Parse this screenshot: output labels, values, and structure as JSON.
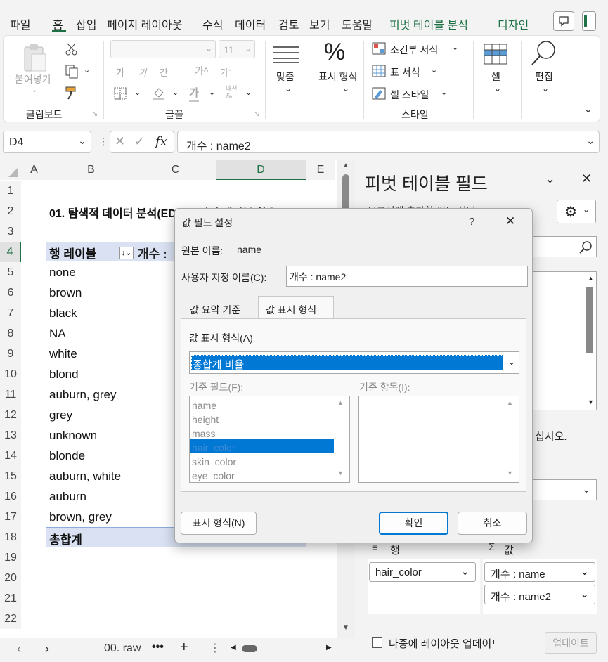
{
  "menu": {
    "file": "파일",
    "home": "홈",
    "insert": "삽입",
    "page_layout": "페이지 레이아웃",
    "formulas": "수식",
    "data": "데이터",
    "review": "검토",
    "view": "보기",
    "help": "도움말",
    "pivot_analyze": "피벗 테이블 분석",
    "design": "디자인"
  },
  "ribbon": {
    "paste": "붙여넣기",
    "clipboard": "클립보드",
    "font_size": "11",
    "font_group": "글꼴",
    "align": "맞춤",
    "number_format": "표시 형식",
    "conditional": "조건부 서식",
    "table_format": "표 서식",
    "cell_style": "셀 스타일",
    "styles": "스타일",
    "cells": "셀",
    "editing": "편집"
  },
  "formula": {
    "name_box": "D4",
    "fx": "fx",
    "value": "개수 : name2"
  },
  "columns": [
    "A",
    "B",
    "C",
    "D",
    "E"
  ],
  "rows": [
    "1",
    "2",
    "3",
    "4",
    "5",
    "6",
    "7",
    "8",
    "9",
    "10",
    "11",
    "12",
    "13",
    "14",
    "15",
    "16",
    "17",
    "18",
    "19",
    "20",
    "21",
    "22"
  ],
  "sheet": {
    "title": "01. 탐색적 데이터 분석(EDA) - 피벗 테이블 활용",
    "row_label_header": "행 레이블",
    "count_header": "개수 : ",
    "items": [
      "none",
      "brown",
      "black",
      "NA",
      "white",
      "blond",
      "auburn, grey",
      "grey",
      "unknown",
      "blonde",
      "auburn, white",
      "auburn",
      "brown, grey"
    ],
    "grand_total": "총합계",
    "tab": "00. raw"
  },
  "pane": {
    "title": "피벗 테이블 필드",
    "subtitle": "보고서에 추가할 필드 선택:",
    "drag_hint": "십시오.",
    "rows_label": "행",
    "values_label": "값",
    "row_field": "hair_color",
    "value_fields": [
      "개수 : name",
      "개수 : name2"
    ],
    "defer_label": "나중에 레이아웃 업데이트",
    "update_btn": "업데이트"
  },
  "dialog": {
    "title": "값 필드 설정",
    "help": "?",
    "source_label": "원본 이름:",
    "source_value": "name",
    "custom_label": "사용자 지정 이름(C):",
    "custom_value": "개수 : name2",
    "tab1": "값 요약 기준",
    "tab2": "값 표시 형식",
    "show_as_label": "값 표시 형식(A)",
    "show_as_value": "종합계 비율",
    "base_field_label": "기준 필드(F):",
    "base_item_label": "기준 항목(I):",
    "base_fields": [
      "name",
      "height",
      "mass",
      "hair_color",
      "skin_color",
      "eye_color"
    ],
    "number_format_btn": "표시 형식(N)",
    "ok": "확인",
    "cancel": "취소"
  },
  "colors": {
    "accent": "#1e7145",
    "select": "#0078d4",
    "header_fill": "#d9e1f2"
  }
}
